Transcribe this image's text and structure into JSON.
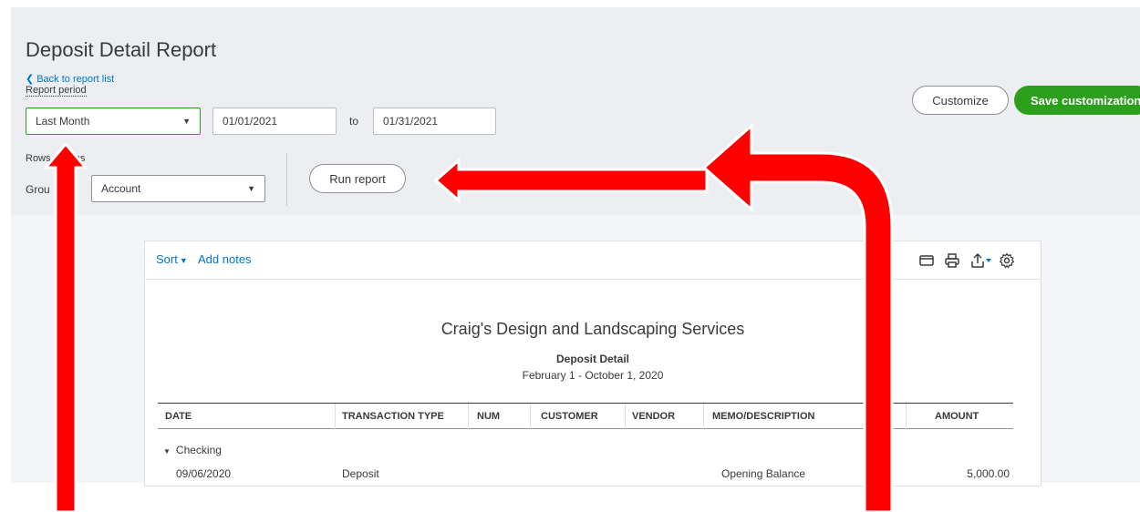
{
  "header": {
    "title": "Deposit Detail Report",
    "back_link": "Back to report list",
    "period_label": "Report period"
  },
  "filters": {
    "period_value": "Last Month",
    "from_date": "01/01/2021",
    "to_label": "to",
    "to_date": "01/31/2021",
    "rows_columns_label": "Rows/Columns",
    "rows_columns_visible": "Rows ",
    "rows_columns_visible_tail": "mns",
    "group_by_label": "Group by",
    "group_by_visible": "Grou",
    "group_by_value": "Account",
    "run_report": "Run report"
  },
  "actions": {
    "customize": "Customize",
    "save_customization": "Save customization"
  },
  "report_toolbar": {
    "sort": "Sort",
    "add_notes": "Add notes"
  },
  "report": {
    "company": "Craig's Design and Landscaping Services",
    "title": "Deposit Detail",
    "date_range": "February 1 - October 1, 2020",
    "columns": [
      "DATE",
      "TRANSACTION TYPE",
      "NUM",
      "CUSTOMER",
      "VENDOR",
      "MEMO/DESCRIPTION",
      "AMOUNT"
    ],
    "group": "Checking",
    "rows": [
      {
        "date": "09/06/2020",
        "type": "Deposit",
        "num": "",
        "customer": "",
        "vendor": "",
        "memo": "Opening Balance",
        "amount": "5,000.00"
      }
    ]
  },
  "annotation": {
    "arrow_color": "#ff0000"
  }
}
